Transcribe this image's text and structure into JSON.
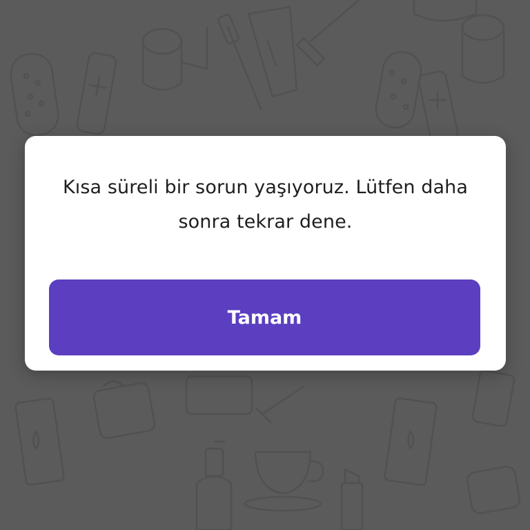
{
  "dialog": {
    "message": "Kısa süreli bir sorun yaşıyoruz. Lütfen daha sonra tekrar dene.",
    "ok_label": "Tamam"
  },
  "colors": {
    "backdrop": "#616161",
    "dialog_background": "#ffffff",
    "button_background": "#5b3fc0",
    "button_text": "#ffffff",
    "message_text": "#1e1e1e"
  },
  "background_icons": [
    "bath-sponge-icon",
    "battery-icon",
    "toilet-paper-icon",
    "toothbrush-icon",
    "toothpaste-tube-icon",
    "razor-icon",
    "soap-dish-icon",
    "lotion-bottle-icon",
    "spray-bottle-icon",
    "tissue-box-icon",
    "teacup-icon",
    "lipstick-icon"
  ]
}
